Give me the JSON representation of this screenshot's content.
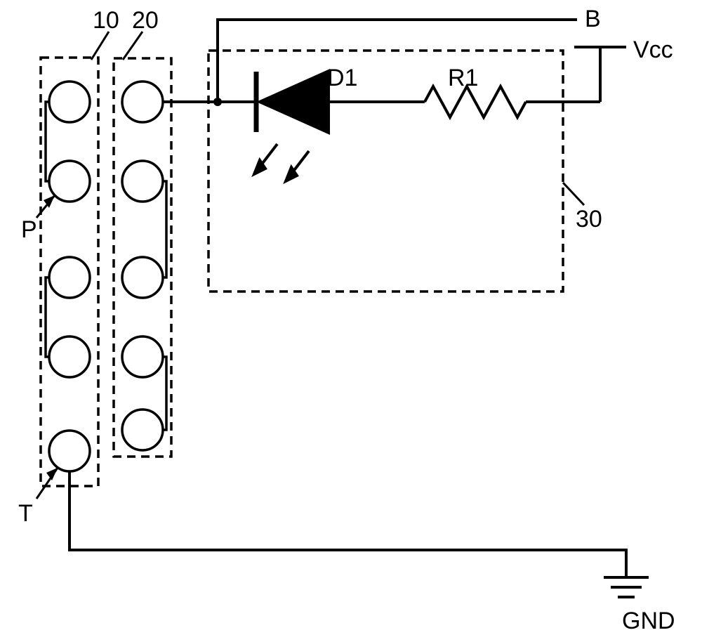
{
  "labels": {
    "block10": "10",
    "block20": "20",
    "block30": "30",
    "diode": "D1",
    "resistor": "R1",
    "nodeB": "B",
    "vcc": "Vcc",
    "gnd": "GND",
    "pinP": "P",
    "pinT": "T"
  }
}
